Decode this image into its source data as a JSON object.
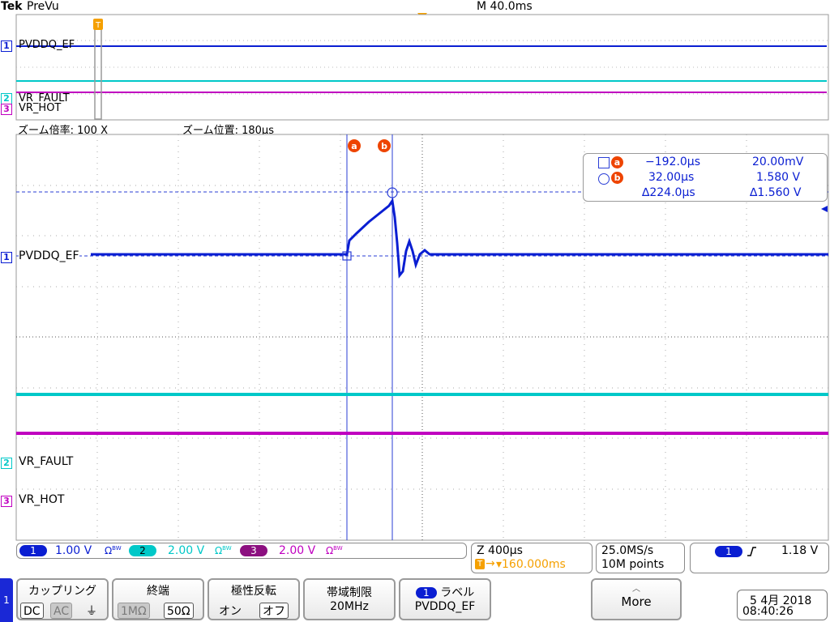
{
  "header": {
    "brand": "Tek",
    "mode": "PreVu",
    "timebase": "M 40.0ms",
    "trigger_marker": "T"
  },
  "channels": [
    {
      "num": "1",
      "label": "PVDDQ_EF",
      "color": "#0a1ed2"
    },
    {
      "num": "2",
      "label": "VR_FAULT",
      "color": "#00c8c8"
    },
    {
      "num": "3",
      "label": "VR_HOT",
      "color": "#c000c0"
    }
  ],
  "zoom": {
    "factor_label": "ズーム倍率: 100 X",
    "position_label": "ズーム位置: 180µs"
  },
  "cursors": {
    "a_symbol": "a",
    "b_symbol": "b",
    "row_a_time": "−192.0µs",
    "row_a_value": "20.00mV",
    "row_b_time": "32.00µs",
    "row_b_value": "1.580 V",
    "delta_time": "∆224.0µs",
    "delta_value": "∆1.560 V"
  },
  "status_bar": {
    "ch1_scale": "1.00 V",
    "ch2_scale": "2.00 V",
    "ch3_scale": "2.00 V",
    "coupling_tag": "Ω",
    "bw_tag": "BW",
    "zoom_time": "Z 400µs",
    "trigger_pos": "▾160.000ms",
    "sample_rate": "25.0MS/s",
    "record_length": "10M points",
    "trig_ch": "1",
    "trig_level": "1.18 V"
  },
  "softkeys": {
    "side_number": "1",
    "coupling": {
      "title": "カップリング",
      "opt_dc": "DC",
      "opt_ac": "AC",
      "opt_gnd": "⏚"
    },
    "termination": {
      "title": "終端",
      "opt_1m": "1MΩ",
      "opt_50": "50Ω"
    },
    "invert": {
      "title": "極性反転",
      "opt_on": "オン",
      "opt_off": "オフ"
    },
    "bandwidth": {
      "title": "帯域制限",
      "value": "20MHz"
    },
    "label": {
      "title": "ラベル",
      "value": "PVDDQ_EF"
    },
    "more": {
      "title": "More"
    }
  },
  "datetime": {
    "date": "5 4月 2018",
    "time": "08:40:26"
  },
  "colors": {
    "ch1": "#0a1ed2",
    "ch2": "#00c8c8",
    "ch3": "#c000c0",
    "trigger": "#f5a000",
    "cursor": "#2a3ed6"
  }
}
